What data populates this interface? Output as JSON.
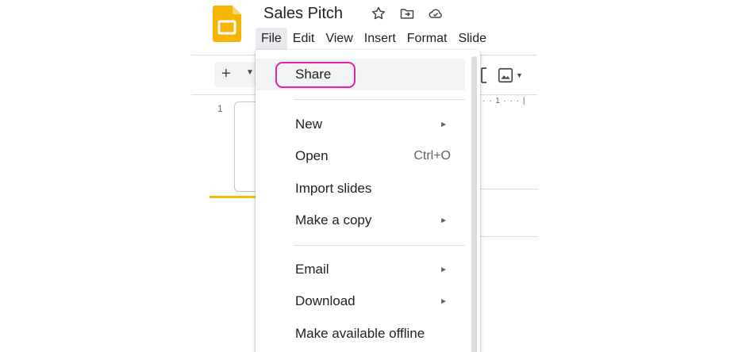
{
  "document": {
    "title": "Sales Pitch"
  },
  "menubar": {
    "items": [
      "File",
      "Edit",
      "View",
      "Insert",
      "Format",
      "Slide"
    ]
  },
  "toolbar": {
    "add_symbol": "+"
  },
  "ruler": {
    "text": "· · 1 · · · |"
  },
  "filmstrip": {
    "slide_number": "1"
  },
  "file_menu": {
    "items": [
      {
        "label": "Share",
        "shortcut": "",
        "submenu": false
      },
      {
        "label": "New",
        "shortcut": "",
        "submenu": true
      },
      {
        "label": "Open",
        "shortcut": "Ctrl+O",
        "submenu": false
      },
      {
        "label": "Import slides",
        "shortcut": "",
        "submenu": false
      },
      {
        "label": "Make a copy",
        "shortcut": "",
        "submenu": true
      },
      {
        "label": "Email",
        "shortcut": "",
        "submenu": true
      },
      {
        "label": "Download",
        "shortcut": "",
        "submenu": true
      },
      {
        "label": "Make available offline",
        "shortcut": "",
        "submenu": false
      }
    ]
  },
  "colors": {
    "slides_yellow": "#f4b400",
    "highlight_pink": "#e91eaa",
    "menu_hover": "#f1f3f4"
  }
}
